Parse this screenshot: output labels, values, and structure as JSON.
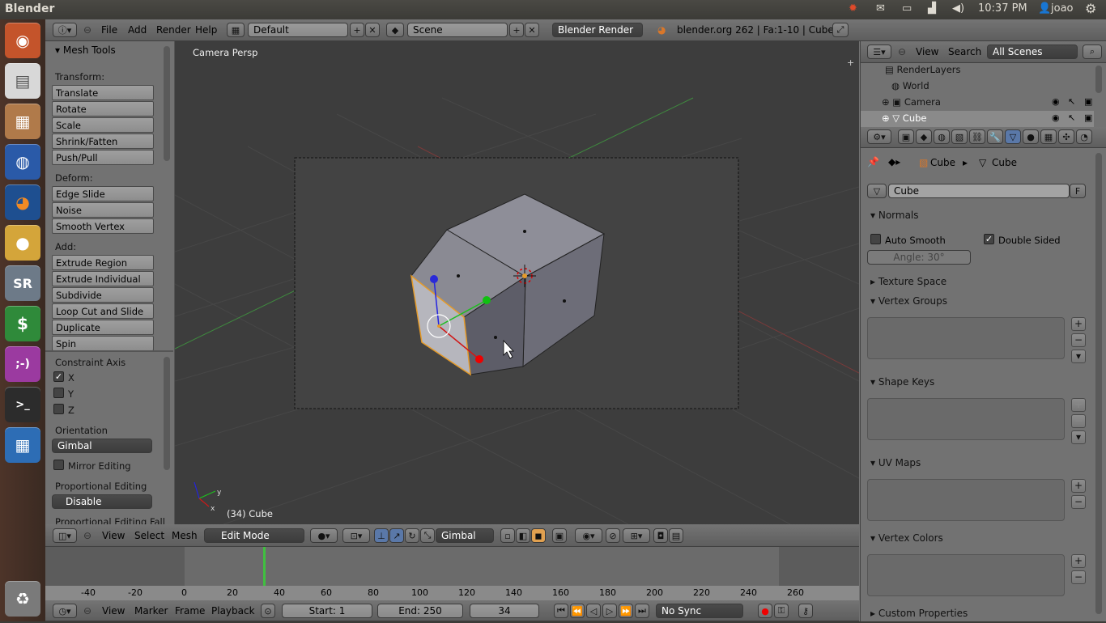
{
  "system": {
    "app_title": "Blender",
    "clock": "10:37 PM",
    "user": "joao"
  },
  "info_header": {
    "menus": [
      "File",
      "Add",
      "Render",
      "Help"
    ],
    "screen_layout": "Default",
    "scene": "Scene",
    "render_engine": "Blender Render",
    "stats": "blender.org 262 | Fa:1-10 | Cube"
  },
  "tool_shelf": {
    "title": "Mesh Tools",
    "transform_label": "Transform:",
    "transform": [
      "Translate",
      "Rotate",
      "Scale",
      "Shrink/Fatten",
      "Push/Pull"
    ],
    "deform_label": "Deform:",
    "deform": [
      "Edge Slide",
      "Noise",
      "Smooth Vertex"
    ],
    "add_label": "Add:",
    "add": [
      "Extrude Region",
      "Extrude Individual",
      "Subdivide",
      "Loop Cut and Slide",
      "Duplicate",
      "Spin"
    ],
    "constraint_label": "Constraint Axis",
    "axes": [
      "X",
      "Y",
      "Z"
    ],
    "orientation_label": "Orientation",
    "orientation_value": "Gimbal",
    "mirror_editing": "Mirror Editing",
    "prop_editing_label": "Proportional Editing",
    "prop_editing_value": "Disable",
    "prop_editing_falloff": "Proportional Editing Fall"
  },
  "viewport": {
    "view_name": "Camera Persp",
    "object_info": "(34) Cube"
  },
  "view3d_header": {
    "menus": [
      "View",
      "Select",
      "Mesh"
    ],
    "mode": "Edit Mode",
    "orientation": "Gimbal"
  },
  "timeline": {
    "ruler": [
      "-40",
      "-20",
      "0",
      "20",
      "40",
      "60",
      "80",
      "100",
      "120",
      "140",
      "160",
      "180",
      "200",
      "220",
      "240",
      "260"
    ],
    "menus": [
      "View",
      "Marker",
      "Frame",
      "Playback"
    ],
    "start": "Start: 1",
    "end": "End: 250",
    "current": "34",
    "sync": "No Sync"
  },
  "outliner": {
    "menus": [
      "View",
      "Search"
    ],
    "filter": "All Scenes",
    "items": [
      "RenderLayers",
      "World",
      "Camera",
      "Cube"
    ]
  },
  "properties": {
    "breadcrumb": [
      "Cube",
      "Cube"
    ],
    "datablock_name": "Cube",
    "datablock_flag": "F",
    "normals_title": "Normals",
    "auto_smooth": "Auto Smooth",
    "double_sided": "Double Sided",
    "angle": "Angle: 30°",
    "texture_space": "Texture Space",
    "vertex_groups": "Vertex Groups",
    "shape_keys": "Shape Keys",
    "uv_maps": "UV Maps",
    "vertex_colors": "Vertex Colors",
    "custom_properties": "Custom Properties"
  }
}
